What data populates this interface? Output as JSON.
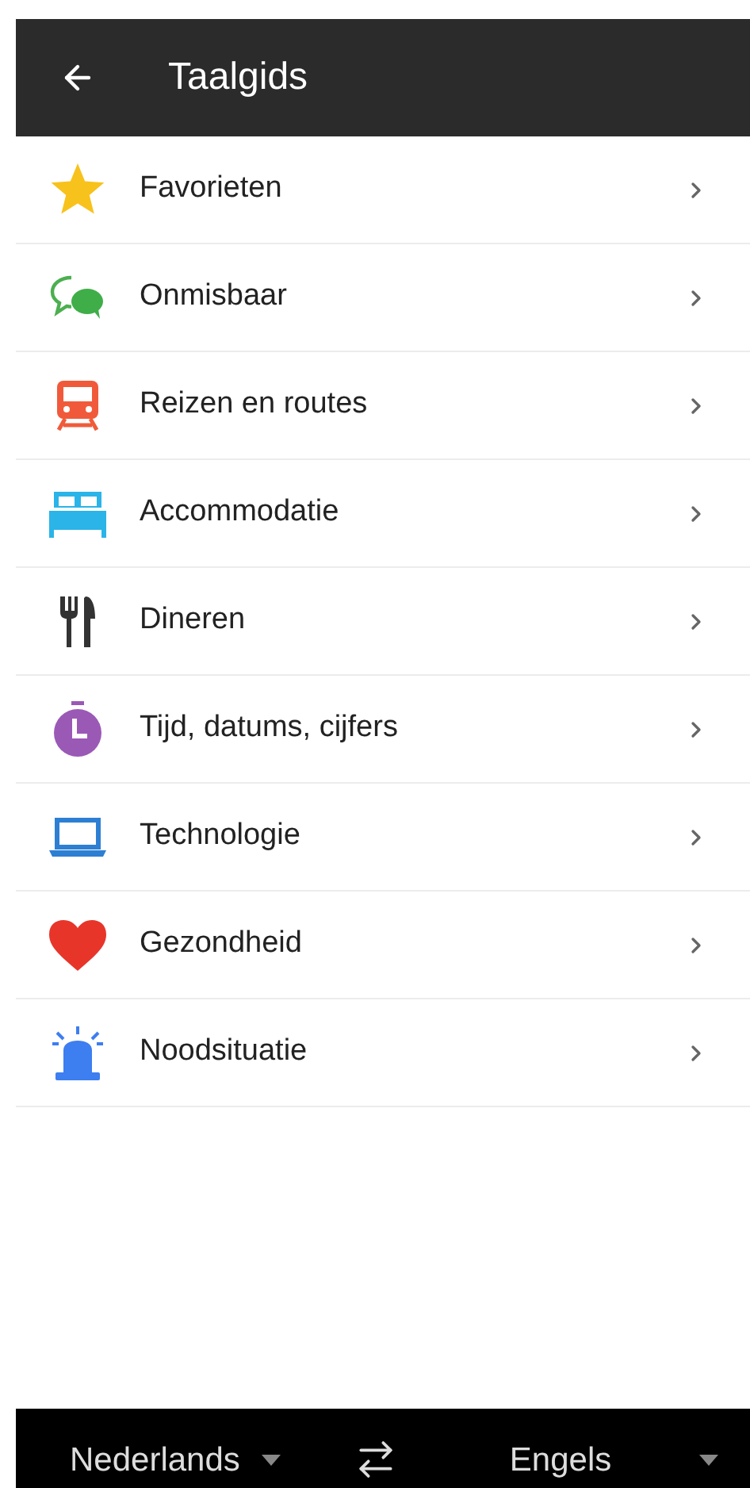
{
  "header": {
    "title": "Taalgids"
  },
  "categories": [
    {
      "kind": "star",
      "label": "Favorieten"
    },
    {
      "kind": "chat",
      "label": "Onmisbaar"
    },
    {
      "kind": "train",
      "label": "Reizen en routes"
    },
    {
      "kind": "bed",
      "label": "Accommodatie"
    },
    {
      "kind": "cutlery",
      "label": "Dineren"
    },
    {
      "kind": "timer",
      "label": "Tijd, datums, cijfers"
    },
    {
      "kind": "laptop",
      "label": "Technologie"
    },
    {
      "kind": "heart",
      "label": "Gezondheid"
    },
    {
      "kind": "siren",
      "label": "Noodsituatie"
    }
  ],
  "language_bar": {
    "source": "Nederlands",
    "target": "Engels"
  }
}
